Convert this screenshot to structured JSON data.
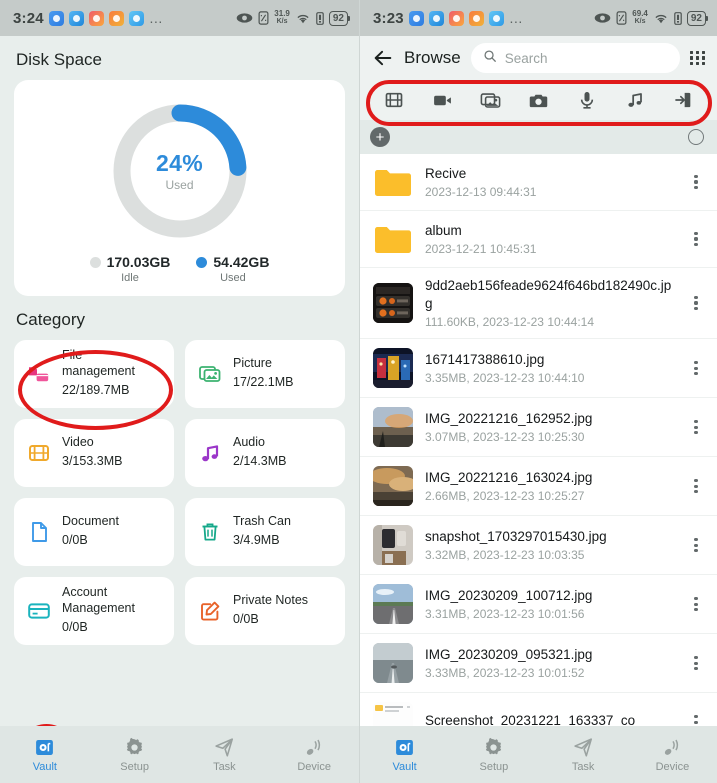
{
  "left": {
    "statusbar": {
      "time": "3:24",
      "app_icons": [
        "app-icon-1",
        "app-icon-2",
        "app-icon-3",
        "app-icon-4",
        "app-icon-5"
      ],
      "overflow": "…",
      "net_rate": "31.9",
      "net_rate_unit": "K/s",
      "battery": "92",
      "icons": [
        "eye-icon",
        "nfc-icon",
        "wifi-icon",
        "sim-icon",
        "battery-icon"
      ]
    },
    "disk": {
      "section_title": "Disk Space",
      "percent_label": "24%",
      "percent_sub": "Used",
      "legend": [
        {
          "value": "170.03GB",
          "label": "Idle",
          "color": "#dcdfde"
        },
        {
          "value": "54.42GB",
          "label": "Used",
          "color": "#2d8bda"
        }
      ]
    },
    "category": {
      "section_title": "Category",
      "tiles": [
        {
          "name": "File\nmanagement",
          "meta": "22/189.7MB",
          "icon": "file-management-icon",
          "color": "#e6357f"
        },
        {
          "name": "Picture",
          "meta": "17/22.1MB",
          "icon": "picture-icon",
          "color": "#3cb371"
        },
        {
          "name": "Video",
          "meta": "3/153.3MB",
          "icon": "video-icon",
          "color": "#f0a92c"
        },
        {
          "name": "Audio",
          "meta": "2/14.3MB",
          "icon": "audio-icon",
          "color": "#9b37c9"
        },
        {
          "name": "Document",
          "meta": "0/0B",
          "icon": "document-icon",
          "color": "#3f9ae8"
        },
        {
          "name": "Trash Can",
          "meta": "3/4.9MB",
          "icon": "trash-icon",
          "color": "#15a88a"
        },
        {
          "name": "Account\nManagement",
          "meta": "0/0B",
          "icon": "credit-card-icon",
          "color": "#1ab3bd"
        },
        {
          "name": "Private Notes",
          "meta": "0/0B",
          "icon": "note-edit-icon",
          "color": "#e8632a"
        }
      ]
    },
    "bottomnav": {
      "items": [
        {
          "label": "Vault",
          "icon": "vault-icon",
          "active": true
        },
        {
          "label": "Setup",
          "icon": "gear-icon",
          "active": false
        },
        {
          "label": "Task",
          "icon": "send-icon",
          "active": false
        },
        {
          "label": "Device",
          "icon": "device-signal-icon",
          "active": false
        }
      ]
    }
  },
  "right": {
    "statusbar": {
      "time": "3:23",
      "overflow": "…",
      "net_rate": "69.4",
      "net_rate_unit": "K/s",
      "battery": "92"
    },
    "browse": {
      "back_icon": "back-arrow-icon",
      "title": "Browse",
      "search_placeholder": "Search",
      "search_value": "",
      "search_icon": "search-icon",
      "grid_icon": "grid-view-icon"
    },
    "toolbar": {
      "items": [
        {
          "icon": "filmstrip-icon",
          "name": "filmstrip"
        },
        {
          "icon": "video-camera-icon",
          "name": "video-camera"
        },
        {
          "icon": "gallery-icon",
          "name": "gallery"
        },
        {
          "icon": "camera-icon",
          "name": "camera"
        },
        {
          "icon": "microphone-icon",
          "name": "microphone"
        },
        {
          "icon": "music-note-icon",
          "name": "music-note"
        },
        {
          "icon": "import-icon",
          "name": "import"
        }
      ]
    },
    "action_row": {
      "add_label": "+",
      "add_icon": "plus-icon",
      "select_icon": "select-circle-icon"
    },
    "files": [
      {
        "type": "folder",
        "name": "Recive",
        "meta": "2023-12-13 09:44:31"
      },
      {
        "type": "folder",
        "name": "album",
        "meta": "2023-12-21 10:45:31"
      },
      {
        "type": "image",
        "name": "9dd2aeb156feade9624f646bd182490c.jpg",
        "meta": "111.60KB, 2023-12-23 10:44:14",
        "thumb": "thumb-dark-ui"
      },
      {
        "type": "image",
        "name": "1671417388610.jpg",
        "meta": "3.35MB, 2023-12-23 10:44:10",
        "thumb": "thumb-night-street"
      },
      {
        "type": "image",
        "name": "IMG_20221216_162952.jpg",
        "meta": "3.07MB, 2023-12-23 10:25:30",
        "thumb": "thumb-sunset-sea"
      },
      {
        "type": "image",
        "name": "IMG_20221216_163024.jpg",
        "meta": "2.66MB, 2023-12-23 10:25:27",
        "thumb": "thumb-sunset-clouds"
      },
      {
        "type": "image",
        "name": "snapshot_1703297015430.jpg",
        "meta": "3.32MB, 2023-12-23 10:03:35",
        "thumb": "thumb-room"
      },
      {
        "type": "image",
        "name": "IMG_20230209_100712.jpg",
        "meta": "3.31MB, 2023-12-23 10:01:56",
        "thumb": "thumb-road-day"
      },
      {
        "type": "image",
        "name": "IMG_20230209_095321.jpg",
        "meta": "3.33MB, 2023-12-23 10:01:52",
        "thumb": "thumb-road-fog"
      },
      {
        "type": "document",
        "name": "Screenshot_20231221_163337_co",
        "meta": "",
        "thumb": "thumb-doc"
      }
    ],
    "bottomnav": {
      "items": [
        {
          "label": "Vault",
          "icon": "vault-icon",
          "active": true
        },
        {
          "label": "Setup",
          "icon": "gear-icon",
          "active": false
        },
        {
          "label": "Task",
          "icon": "send-icon",
          "active": false
        },
        {
          "label": "Device",
          "icon": "device-signal-icon",
          "active": false
        }
      ]
    }
  },
  "annotations": {
    "color": "#e01b1b",
    "shapes": [
      "ellipse-file-management",
      "ellipse-vault-tab",
      "rounded-toolbar-row"
    ]
  },
  "chart_data": {
    "type": "pie",
    "title": "Disk Space",
    "categories": [
      "Used",
      "Idle"
    ],
    "values": [
      54.42,
      170.03
    ],
    "units": "GB",
    "percent_used": 24,
    "colors": [
      "#2d8bda",
      "#dcdfde"
    ],
    "legend_position": "bottom",
    "donut": true
  }
}
